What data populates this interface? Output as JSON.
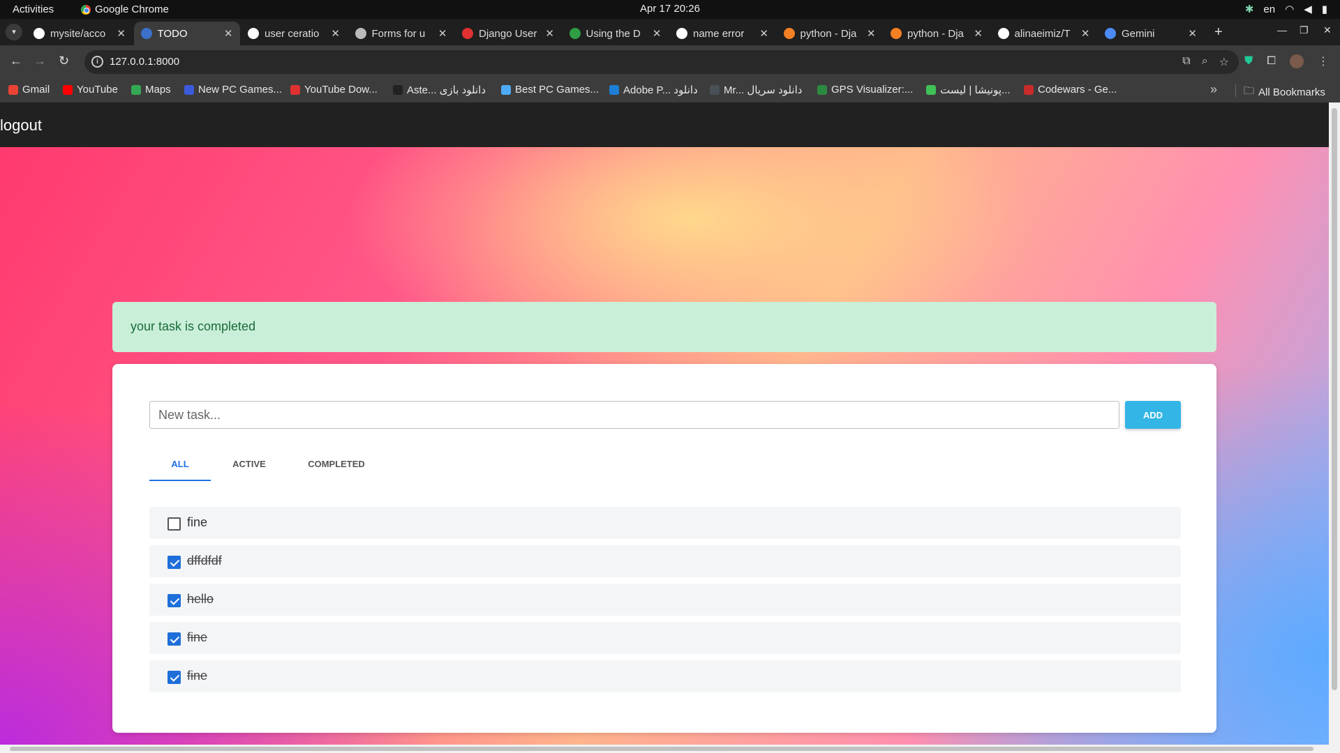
{
  "system": {
    "activities": "Activities",
    "app_name": "Google Chrome",
    "clock": "Apr 17  20:26",
    "lang": "en"
  },
  "tabs": [
    {
      "title": "mysite/acco",
      "favicon": "github-icon"
    },
    {
      "title": "TODO",
      "favicon": "mdb-icon",
      "active": true
    },
    {
      "title": "user ceratio",
      "favicon": "google-icon"
    },
    {
      "title": "Forms for u",
      "favicon": "forms-icon"
    },
    {
      "title": "Django User",
      "favicon": "django-icon"
    },
    {
      "title": "Using the D",
      "favicon": "dj-icon"
    },
    {
      "title": "name error",
      "favicon": "google-icon"
    },
    {
      "title": "python - Dja",
      "favicon": "stackoverflow-icon"
    },
    {
      "title": "python - Dja",
      "favicon": "stackoverflow-icon"
    },
    {
      "title": "alinaeimiz/T",
      "favicon": "github-icon"
    },
    {
      "title": "Gemini",
      "favicon": "gemini-icon"
    }
  ],
  "address_bar": {
    "url": "127.0.0.1:8000"
  },
  "bookmarks": [
    {
      "label": "Gmail",
      "color": "#ea4335"
    },
    {
      "label": "YouTube",
      "color": "#ff0000"
    },
    {
      "label": "Maps",
      "color": "#34a853"
    },
    {
      "label": "New PC Games...",
      "color": "#3b5bdb"
    },
    {
      "label": "YouTube Dow...",
      "color": "#e03131"
    },
    {
      "label": "Aste... دانلود بازی",
      "color": "#222222"
    },
    {
      "label": "Best PC Games...",
      "color": "#4dabf7"
    },
    {
      "label": "Adobe P... دانلود",
      "color": "#1c7ed6"
    },
    {
      "label": "Mr... دانلود سریال",
      "color": "#495057"
    },
    {
      "label": "GPS Visualizer:...",
      "color": "#2b8a3e"
    },
    {
      "label": "پونیشا | لیست...",
      "color": "#40c057"
    },
    {
      "label": "Codewars - Ge...",
      "color": "#c92a2a"
    }
  ],
  "all_bookmarks": "All Bookmarks",
  "page": {
    "nav": {
      "logout": "logout"
    },
    "alert": "your task is completed",
    "new_task_placeholder": "New task...",
    "add_label": "ADD",
    "filter_tabs": [
      {
        "label": "ALL",
        "active": true
      },
      {
        "label": "ACTIVE",
        "active": false
      },
      {
        "label": "COMPLETED",
        "active": false
      }
    ],
    "tasks": [
      {
        "text": "fine",
        "completed": false
      },
      {
        "text": "dffdfdf",
        "completed": true
      },
      {
        "text": "hello",
        "completed": true
      },
      {
        "text": "fine",
        "completed": true
      },
      {
        "text": "fine",
        "completed": true
      }
    ]
  },
  "colors": {
    "accent": "#1e70e6",
    "add_button": "#33b5e5",
    "alert_bg": "#c9efd9",
    "alert_text": "#1b6b3a"
  }
}
